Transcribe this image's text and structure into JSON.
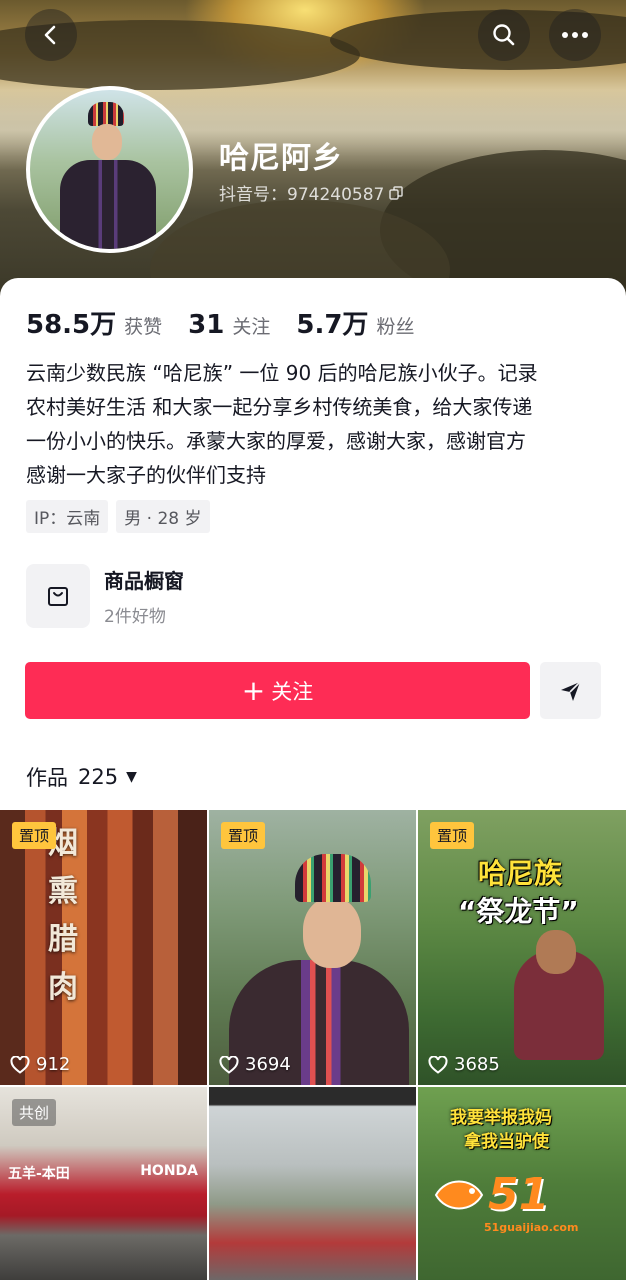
{
  "header": {
    "nickname": "哈尼阿乡",
    "douyin_id": "抖音号：974240587"
  },
  "stats": [
    {
      "num": "58.5万",
      "label": "获赞"
    },
    {
      "num": "31",
      "label": "关注"
    },
    {
      "num": "5.7万",
      "label": "粉丝"
    }
  ],
  "bio": [
    "云南少数民族 “哈尼族” 一位 90 后的哈尼族小伙子。记录",
    "农村美好生活 和大家一起分享乡村传统美食，给大家传递",
    "一份小小的快乐。承蒙大家的厚爱，感谢大家，感谢官方",
    "感谢一大家子的伙伴们支持"
  ],
  "tags": [
    "IP：云南",
    "男 · 28 岁"
  ],
  "shop": {
    "title": "商品橱窗",
    "subtitle": "2件好物"
  },
  "actions": {
    "follow_label": "关注",
    "follow_symbol": "+"
  },
  "works": {
    "label": "作品",
    "count": "225"
  },
  "videos": [
    {
      "badge": "置顶",
      "likes": "912",
      "overlay": [
        "烟",
        "熏",
        "腊",
        "肉"
      ]
    },
    {
      "badge": "置顶",
      "likes": "3694"
    },
    {
      "badge": "置顶",
      "likes": "3685",
      "overlay": [
        "哈尼族",
        "“祭龙节”"
      ]
    },
    {
      "badge": "共创",
      "overlay": [
        "五羊-本田",
        "HONDA"
      ]
    },
    {
      "badge": ""
    },
    {
      "badge": "",
      "overlay": [
        "我要举报我妈",
        "拿我当驴使"
      ],
      "watermark": [
        "51",
        "51guaijiao.com"
      ]
    }
  ],
  "colors": {
    "accent": "#fe2c55",
    "pin": "#ffc53d",
    "text": "#161823"
  },
  "icons": [
    "back-icon",
    "search-icon",
    "more-icon",
    "copy-icon",
    "shop-bag-icon",
    "share-icon",
    "heart-icon",
    "triangle-down-icon"
  ]
}
